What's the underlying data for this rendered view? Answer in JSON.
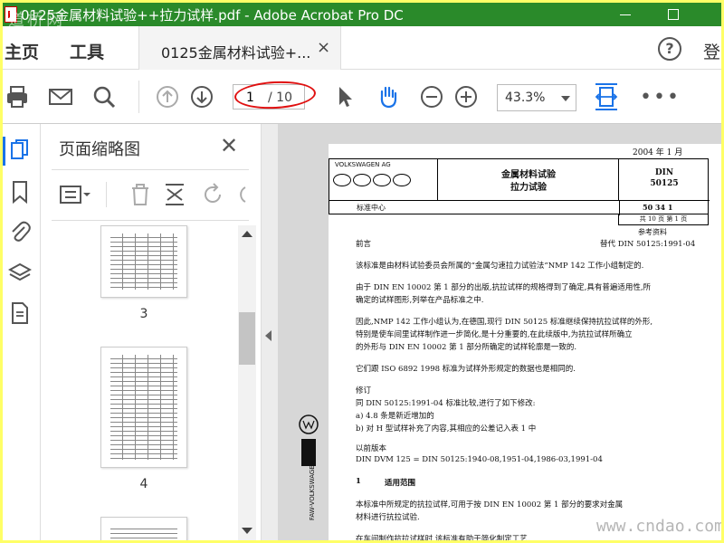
{
  "window": {
    "title": "0125金属材料试验++拉力试样.pdf - Adobe Acrobat Pro DC",
    "watermark_tl": "道桥网"
  },
  "menu": {
    "home": "主页",
    "tools": "工具",
    "tab_label": "0125金属材料试验+...",
    "tab_close": "×",
    "help": "?",
    "login": "登"
  },
  "toolbar": {
    "current_page": "1",
    "total_pages": "/ 10",
    "zoom": "43.3%",
    "more": "•••"
  },
  "thumbnails": {
    "title": "页面缩略图",
    "close": "✕",
    "pages": [
      {
        "label": "3"
      },
      {
        "label": "4"
      }
    ]
  },
  "doc": {
    "date": "2004 年 1 月",
    "company": "VOLKSWAGEN AG",
    "title_line1": "金属材料试验",
    "title_line2": "拉力试验",
    "din_line1": "DIN",
    "din_line2": "50125",
    "standards_center": "标准中心",
    "doc_number": "50 34 1",
    "pages_info": "共 10 页 第 1 页",
    "reference": "参考资料",
    "foreword": "前言",
    "replaces": "替代 DIN 50125:1991-04",
    "p1": "该标准是由材料试验委员会所属的“金属匀速拉力试验法”NMP 142 工作小组制定的.",
    "p2a": "由于 DIN EN 10002 第 1 部分的出版,抗拉试样的规格得到了确定,具有普遍适用性,所",
    "p2b": "确定的试样图形,列举在产品标准之中.",
    "p3a": "因此,NMP 142 工作小组认为,在德国,现行 DIN 50125 标准继续保持抗拉试样的外形,",
    "p3b": "特别是使车间里试样制作进一步简化,是十分重要的,在此续版中,为抗拉试样所确立",
    "p3c": "的外形与 DIN EN 10002 第 1 部分所确定的试样轮廓是一致的.",
    "p4": "它们跟 ISO 6892 1998 标准为试样外形规定的数据也是相同的.",
    "rev_title": "修订",
    "rev_intro": "同 DIN 50125:1991-04 标准比较,进行了如下修改:",
    "rev_a": "a)  4.8 条是新近增加的",
    "rev_b": "b)  对 H 型试样补充了内容,其相应的公差记入表 1 中",
    "prev_title": "以前版本",
    "prev_list": "DIN DVM 125 = DIN 50125:1940-08,1951-04,1986-03,1991-04",
    "sec1_num": "1",
    "sec1_title": "适用范围",
    "s1a": "本标准中所规定的抗拉试样,可用于按 DIN EN 10002 第 1 部分的要求对金属",
    "s1b": "材料进行抗拉试验.",
    "s1c": "在车间制作抗拉试样时,该标准有助于简化制定工艺.",
    "side_logo": "FAW-VOLKSWAGEN",
    "watermark_br": "www.cndao.com"
  },
  "colors": {
    "titlebar": "#2a8a2a",
    "highlight": "#e01010",
    "border_frame": "#ffff66"
  }
}
